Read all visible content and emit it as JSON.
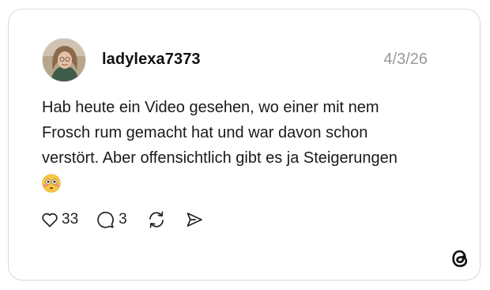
{
  "post": {
    "username": "ladylexa7373",
    "date": "4/3/26",
    "text_lines": [
      "Hab heute ein Video gesehen, wo einer mit nem",
      "Frosch rum gemacht hat und war davon schon",
      "verstört. Aber offensichtlich gibt es ja Steigerungen"
    ],
    "emoji": "flushed-face-emoji"
  },
  "actions": {
    "like_count": "33",
    "reply_count": "3",
    "like_icon": "heart-icon",
    "reply_icon": "comment-bubble-icon",
    "repost_icon": "repost-icon",
    "share_icon": "send-icon"
  },
  "brand": {
    "logo_icon": "threads-logo-icon"
  },
  "colors": {
    "card_border": "#d9d9d9",
    "text": "#1a1a1a",
    "muted": "#999999"
  }
}
